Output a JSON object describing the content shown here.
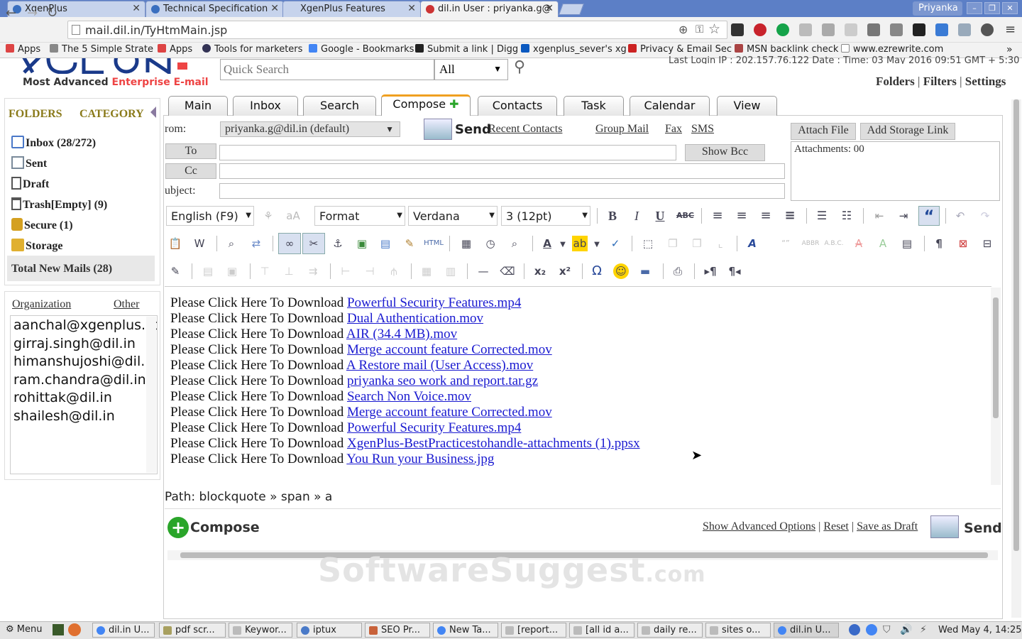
{
  "browser": {
    "tabs": [
      {
        "title": "XgenPlus"
      },
      {
        "title": "Technical Specification"
      },
      {
        "title": "XgenPlus Features"
      },
      {
        "title": "dil.in User : priyanka.g@"
      }
    ],
    "profile": "Priyanka",
    "url": "mail.dil.in/TyHtmMain.jsp",
    "bookmarks": [
      "Apps",
      "The 5 Simple Strate",
      "Apps",
      "Tools for marketers",
      "Google - Bookmarks",
      "Submit a link | Digg",
      "xgenplus_sever's xg",
      "Privacy & Email Sec",
      "MSN backlink check",
      "www.ezrewrite.com"
    ]
  },
  "header": {
    "logo_tagline_a": "Most Advanced",
    "logo_tagline_b": "Enterprise E-mail",
    "search_placeholder": "Quick Search",
    "search_scope": "All",
    "last_login": "Last Login IP : 202.157.76.122 Date : Time: 03 May 2016 09:51 GMT + 5:30",
    "links": [
      "Folders",
      "Filters",
      "Settings"
    ]
  },
  "sidebar": {
    "folders_heading": "FOLDERS",
    "category_heading": "CATEGORY",
    "folders": [
      {
        "name": "Inbox",
        "count": " (28/272)",
        "color": "#4a78c8"
      },
      {
        "name": "Sent",
        "count": "",
        "color": "#7a8a9a"
      },
      {
        "name": "Draft",
        "count": "",
        "color": "#555"
      },
      {
        "name": "Trash[Empty]",
        "count": " (9)",
        "color": "#555"
      },
      {
        "name": "Secure",
        "count": " (1)",
        "color": "#d4a020"
      },
      {
        "name": "Storage",
        "count": "",
        "color": "#e0b030"
      }
    ],
    "total_new": "Total New Mails (28)",
    "contact_tabs": [
      "Organization",
      "Other"
    ],
    "contacts": [
      "aanchal@xgenplus.com",
      "girraj.singh@dil.in",
      "himanshujoshi@dil.in",
      "ram.chandra@dil.in",
      "rohittak@dil.in",
      "shailesh@dil.in"
    ]
  },
  "nav_tabs": [
    "Main",
    "Inbox",
    "Search",
    "Compose",
    "Contacts",
    "Task",
    "Calendar",
    "View"
  ],
  "compose": {
    "from_label": "rom:",
    "from_value": "priyanka.g@dil.in (default)",
    "send_label": "Send",
    "recent_contacts": "Recent Contacts",
    "group_mail": "Group Mail",
    "fax": "Fax",
    "sms": "SMS",
    "to_label": "To",
    "cc_label": "Cc",
    "subject_label": "ubject:",
    "show_bcc": "Show Bcc",
    "attach_file": "Attach File",
    "add_storage_link": "Add Storage Link",
    "attachments": "Attachments: 00"
  },
  "editor_toolbar": {
    "language": "English (F9)",
    "format": "Format",
    "font": "Verdana",
    "size": "3 (12pt)"
  },
  "editor": {
    "lines": [
      {
        "prefix": "Please Click Here To Download ",
        "link": "Powerful Security Features.mp4"
      },
      {
        "prefix": "Please Click Here To Download ",
        "link": "Dual Authentication.mov"
      },
      {
        "prefix": "Please Click Here To Download ",
        "link": "AIR (34.4 MB).mov"
      },
      {
        "prefix": "Please Click Here To Download ",
        "link": "Merge account feature  Corrected.mov"
      },
      {
        "prefix": "Please Click Here To Download ",
        "link": "A  Restore mail (User Access).mov"
      },
      {
        "prefix": "Please Click Here To Download ",
        "link": "priyanka seo work and report.tar.gz"
      },
      {
        "prefix": "Please Click Here To Download ",
        "link": "Search  Non Voice.mov"
      },
      {
        "prefix": "Please Click Here To Download ",
        "link": "Merge account feature  Corrected.mov"
      },
      {
        "prefix": "Please Click Here To Download ",
        "link": "Powerful Security Features.mp4"
      },
      {
        "prefix": "Please Click Here To Download ",
        "link": "XgenPlus-BestPracticestohandle-attachments (1).ppsx"
      },
      {
        "prefix": "Please Click Here To Download ",
        "link": "You Run your Business.jpg"
      }
    ],
    "path": "Path: blockquote » span » a"
  },
  "footer": {
    "compose_label": "Compose",
    "show_advanced": "Show Advanced Options",
    "reset": "Reset",
    "save_draft": "Save as Draft",
    "send_label": "Send",
    "sep": "|"
  },
  "watermark": {
    "main": "SoftwareSuggest",
    "suffix": ".com"
  },
  "taskbar": {
    "menu": "Menu",
    "tasks": [
      "dil.in U...",
      "pdf scr...",
      "Keywor...",
      "iptux",
      "SEO Pr...",
      "New Ta...",
      "[report...",
      "[all id a...",
      "daily re...",
      "sites o...",
      "dil.in U..."
    ],
    "clock": "Wed May  4, 14:25"
  },
  "colors": {
    "accent": "#f0a020",
    "link": "#1a1ad0",
    "folder_heading": "#8a7a1a",
    "tabstrip": "#5c7fc6"
  }
}
